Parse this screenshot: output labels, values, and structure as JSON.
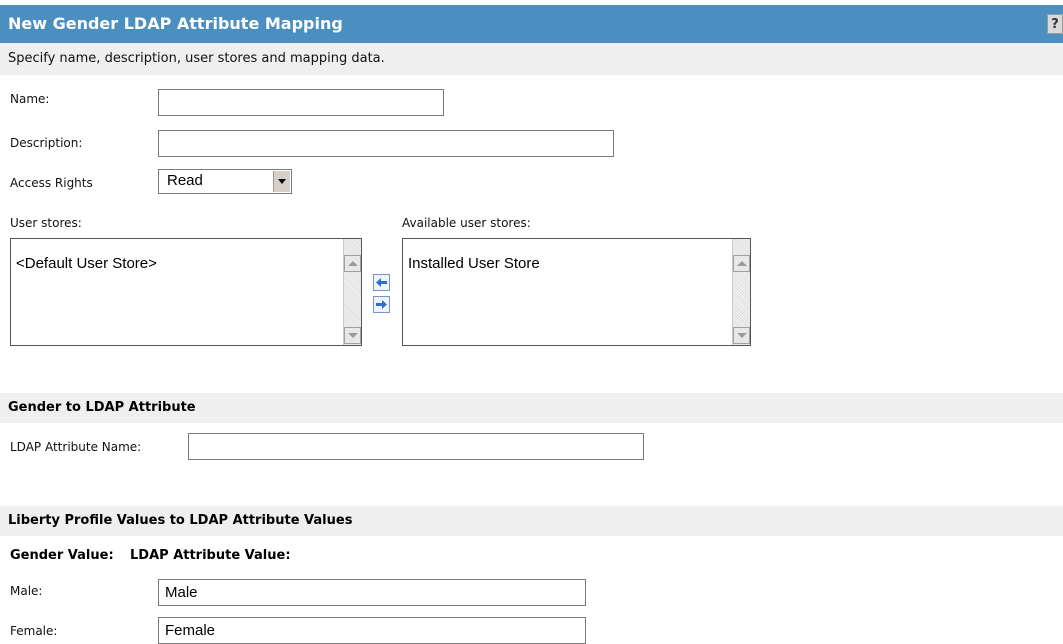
{
  "header": {
    "title": "New Gender LDAP Attribute Mapping",
    "help_label": "?",
    "subtitle": "Specify name, description, user stores and mapping data."
  },
  "form": {
    "name_label": "Name:",
    "name_value": "",
    "description_label": "Description:",
    "description_value": "",
    "access_rights_label": "Access Rights",
    "access_rights_value": "Read"
  },
  "user_stores": {
    "selected_label": "User stores:",
    "selected_items": [
      "<Default User Store>"
    ],
    "available_label": "Available user stores:",
    "available_items": [
      "Installed User Store"
    ]
  },
  "ldap_section": {
    "title": "Gender to LDAP Attribute",
    "attribute_name_label": "LDAP Attribute Name:",
    "attribute_name_value": ""
  },
  "values_section": {
    "title": "Liberty Profile Values to LDAP Attribute Values",
    "gender_value_header": "Gender Value:",
    "ldap_value_header": "LDAP Attribute Value:",
    "rows": [
      {
        "label": "Male:",
        "value": "Male"
      },
      {
        "label": "Female:",
        "value": "Female"
      }
    ]
  },
  "colors": {
    "title_bar": "#4b8fc0",
    "section_bar": "#efefef"
  }
}
